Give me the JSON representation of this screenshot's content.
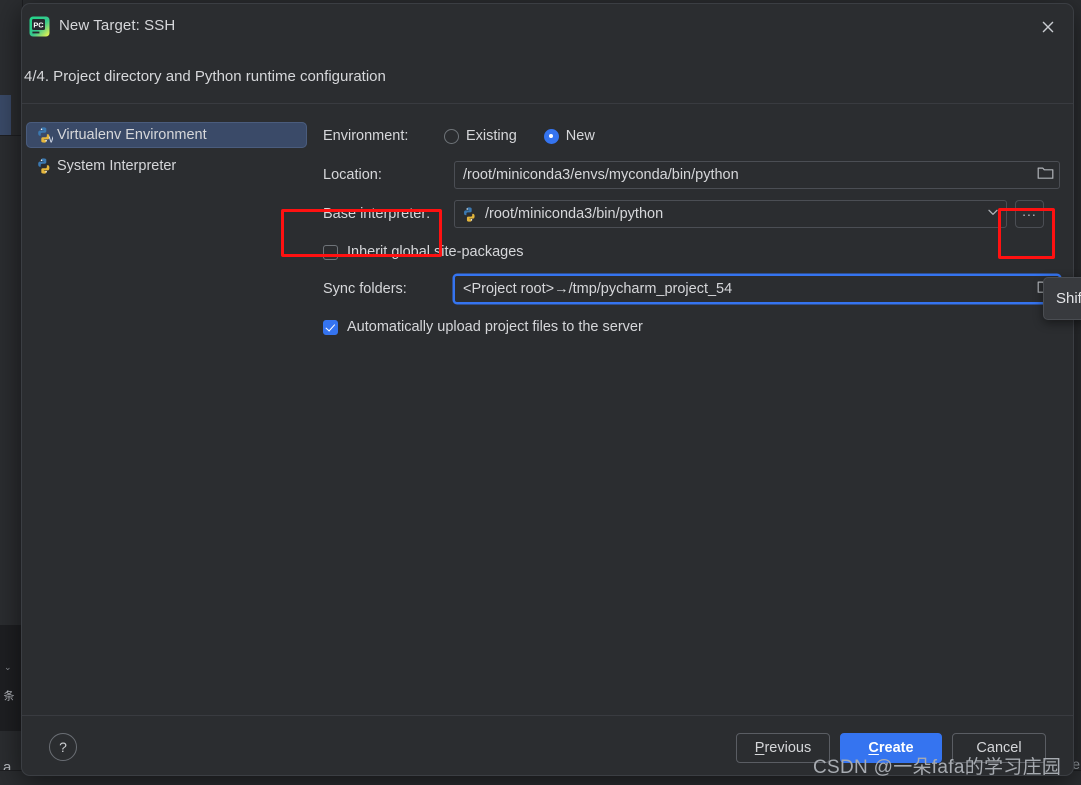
{
  "window": {
    "title": "New Target: SSH",
    "app_icon": "pycharm-icon",
    "close_icon": "close-icon"
  },
  "step_heading": "4/4. Project directory and Python runtime configuration",
  "sidebar": {
    "items": [
      {
        "label": "Virtualenv Environment",
        "icon": "python-virtualenv-icon",
        "selected": true
      },
      {
        "label": "System Interpreter",
        "icon": "python-icon",
        "selected": false
      }
    ]
  },
  "form": {
    "environment": {
      "label": "Environment:",
      "options": [
        {
          "label": "Existing",
          "selected": false
        },
        {
          "label": "New",
          "selected": true
        }
      ]
    },
    "location": {
      "label": "Location:",
      "value": "/root/miniconda3/envs/myconda/bin/python",
      "browse_icon": "folder-icon",
      "focused": false
    },
    "base_interpreter": {
      "label": "Base interpreter:",
      "value": "/root/miniconda3/bin/python",
      "icon": "python-icon",
      "dropdown_icon": "chevron-down-icon",
      "ellipsis_label": "...",
      "highlighted": true
    },
    "inherit_site_packages": {
      "label": "Inherit global site-packages",
      "checked": false
    },
    "sync_folders": {
      "label": "Sync folders:",
      "value": "<Project root>→/tmp/pycharm_project_54",
      "browse_icon": "folder-icon",
      "focused": true
    },
    "auto_upload": {
      "label": "Automatically upload project files to the server",
      "checked": true
    }
  },
  "tooltip": {
    "text": "Shif"
  },
  "footer": {
    "help_label": "?",
    "previous": {
      "label": "Previous",
      "mnemonic": "P"
    },
    "create": {
      "label": "Create",
      "mnemonic": "C",
      "primary": true
    },
    "cancel": {
      "label": "Cancel"
    }
  },
  "watermark": "CSDN @一朵fafa的学习庄园",
  "background": {
    "edge_letter_left": "a",
    "edge_letter_right": "e",
    "caret": "⌄",
    "vertical_text": "条"
  },
  "colors": {
    "accent": "#3574f0",
    "highlight_red": "#ff1111",
    "selection": "#3a4a68",
    "dialog_bg": "#2b2d30",
    "text": "#d6d7da"
  }
}
